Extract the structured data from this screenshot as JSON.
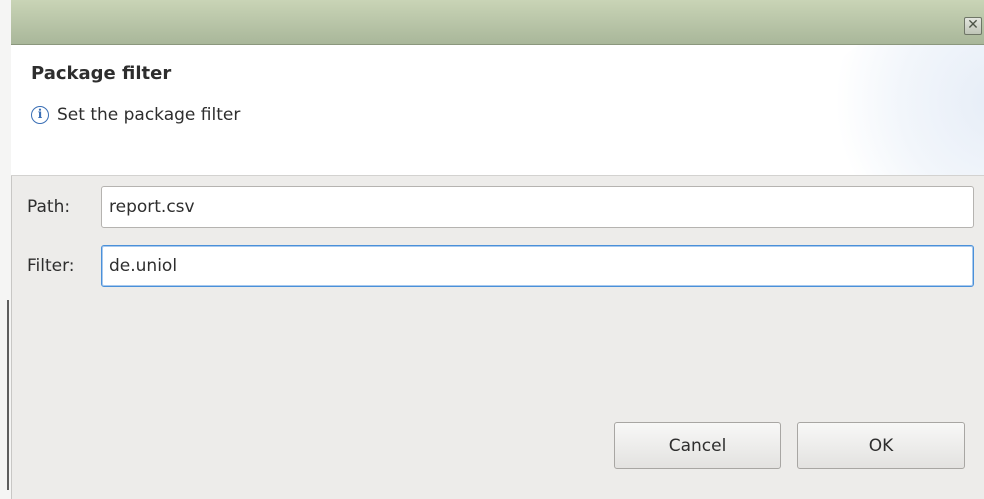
{
  "dialog": {
    "close_glyph": "✕"
  },
  "header": {
    "title": "Package filter",
    "message": "Set the package filter",
    "info_glyph": "i"
  },
  "form": {
    "path": {
      "label": "Path:",
      "value": "report.csv"
    },
    "filter": {
      "label": "Filter:",
      "value": "de.uniol"
    }
  },
  "buttons": {
    "cancel_label": "Cancel",
    "ok_label": "OK"
  },
  "colors": {
    "titlebar": "#b4c0a5",
    "focus_border": "#4a90d9",
    "info_icon": "#3a6fb5"
  }
}
